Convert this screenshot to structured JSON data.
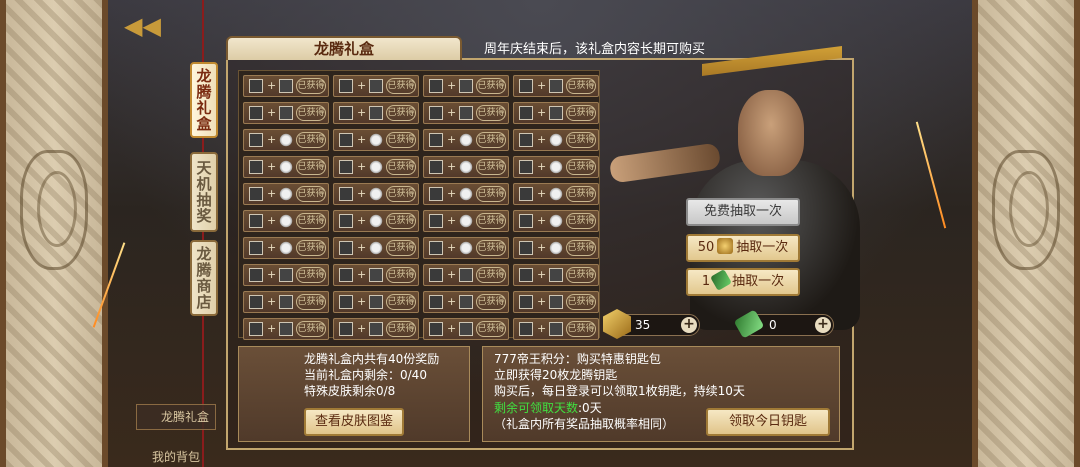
{
  "tabs": [
    {
      "label": "龙腾礼盒",
      "active": true
    },
    {
      "label": "天机抽奖",
      "active": false
    },
    {
      "label": "龙腾商店",
      "active": false
    }
  ],
  "title": "龙腾礼盒",
  "notice": "周年庆结束后，该礼盒内容长期可购买",
  "grid": {
    "claimed_label": "已获得",
    "rows": 10,
    "cols": 4,
    "claimed_rows": [
      0,
      1,
      9
    ],
    "coin_rows": [
      2,
      3,
      4,
      5,
      6
    ]
  },
  "buttons": {
    "free_draw": "免费抽取一次",
    "coin_draw_cost": "50",
    "coin_draw_label": "抽取一次",
    "key_draw_cost": "1",
    "key_draw_label": "抽取一次",
    "view_skins": "查看皮肤图鉴",
    "claim_key": "领取今日钥匙"
  },
  "resources": {
    "coins": "35",
    "keys": "0",
    "add_symbol": "+"
  },
  "left_panel": {
    "line1": "龙腾礼盒内共有40份奖励",
    "line2": "当前礼盒内剩余：0/40",
    "line3": "特殊皮肤剩余0/8"
  },
  "right_panel": {
    "line1": "777帝王积分：购买特惠钥匙包",
    "line2": "立即获得20枚龙腾钥匙",
    "line3": "购买后，每日登录可以领取1枚钥匙，持续10天",
    "line4_label": "剩余可领取天数",
    "line4_value": ":0天",
    "line5": "（礼盒内所有奖品抽取概率相同）"
  },
  "background_tags": {
    "store": "龙腾礼盒",
    "bottom": "我的背包"
  },
  "colors": {
    "accent_gold": "#c08a30",
    "title_text": "#5a2a10",
    "green_text": "#40e040"
  }
}
